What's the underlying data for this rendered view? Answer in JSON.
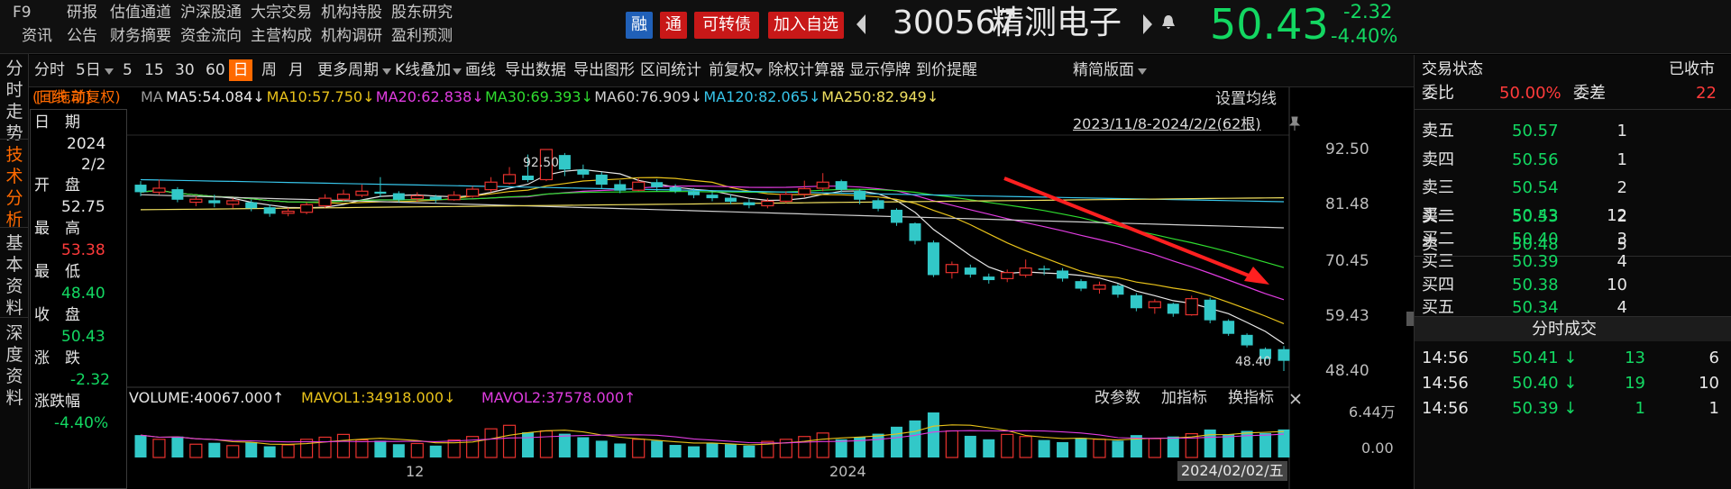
{
  "menu": {
    "row1": [
      "F9",
      "研报",
      "估值通道",
      "沪深股通",
      "大宗交易",
      "机构持股",
      "股东研究"
    ],
    "row2": [
      "资讯",
      "公告",
      "财务摘要",
      "资金流向",
      "主营构成",
      "机构调研",
      "盈利预测"
    ]
  },
  "header": {
    "tags": [
      "融",
      "通",
      "可转债",
      "加入自选"
    ],
    "code": "300567",
    "name": "精测电子",
    "price": "50.43",
    "change": "-2.32",
    "change_pct": "-4.40%"
  },
  "toolbar": {
    "items": [
      "分时",
      "5日",
      "5",
      "15",
      "30",
      "60",
      "日",
      "周",
      "月",
      "更多周期",
      "K线叠加",
      "画线",
      "导出数据",
      "导出图形",
      "区间统计",
      "前复权",
      "除权计算器",
      "显示停牌",
      "到价提醒"
    ],
    "right_label": "精简版面"
  },
  "left_nav": [
    "分时走势",
    "技术分析",
    "基本资料",
    "深度资料"
  ],
  "info": {
    "draggable": "[可拖动]",
    "date_label": "日　期",
    "year": "2024",
    "monthday": "2/2",
    "open_label": "开　盘",
    "open": "52.75",
    "high_label": "最　高",
    "high": "53.38",
    "low_label": "最　低",
    "low": "48.40",
    "close_label": "收　盘",
    "close": "50.43",
    "chg_label": "涨　跌",
    "chg": "-2.32",
    "chgpct_label": "涨跌幅",
    "chgpct": "-4.40%"
  },
  "chart": {
    "mode": "(日线,前复权)",
    "ma_label": "MA",
    "ma": [
      {
        "text": "MA5:54.084↓",
        "color": "#e8e8e8"
      },
      {
        "text": "MA10:57.750↓",
        "color": "#e8c21a"
      },
      {
        "text": "MA20:62.838↓",
        "color": "#e03ce0"
      },
      {
        "text": "MA30:69.393↓",
        "color": "#2fdd2f"
      },
      {
        "text": "MA60:76.909↓",
        "color": "#d0d0d0"
      },
      {
        "text": "MA120:82.065↓",
        "color": "#37c5ea"
      },
      {
        "text": "MA250:82.949↓",
        "color": "#f0e060"
      }
    ],
    "settings": "设置均线",
    "range": "2023/11/8-2024/2/2(62根)",
    "max_label": "92.50",
    "min_label": "48.40",
    "volume_text": "VOLUME:40067.000↑",
    "mavol1": "MAVOL1:34918.000↓",
    "mavol2": "MAVOL2:37578.000↑",
    "vol_buttons": [
      "改参数",
      "加指标",
      "换指标"
    ],
    "y_axis": [
      "92.50",
      "81.48",
      "70.45",
      "59.43",
      "48.40"
    ],
    "vol_axis": [
      "6.44万",
      "0.00"
    ],
    "x_labels": [
      "12",
      "2024"
    ],
    "cursor_date": "2024/02/02/五",
    "arrow_color": "#ff2020",
    "up_color": "#e8322e",
    "down_color": "#32c8c8"
  },
  "chart_data": {
    "type": "candlestick",
    "date_range": "2023/11/8-2024/2/2",
    "ylim": [
      48.4,
      92.5
    ],
    "candles": [
      [
        85.5,
        84.0,
        86.2,
        83.2
      ],
      [
        84.0,
        84.8,
        86.5,
        83.5
      ],
      [
        84.6,
        82.5,
        85.0,
        82.0
      ],
      [
        82.0,
        82.6,
        83.2,
        81.2
      ],
      [
        82.4,
        81.8,
        83.5,
        81.0
      ],
      [
        81.6,
        82.3,
        82.8,
        80.8
      ],
      [
        82.0,
        80.8,
        82.5,
        80.2
      ],
      [
        81.0,
        79.7,
        81.5,
        79.1
      ],
      [
        79.8,
        80.2,
        80.9,
        79.2
      ],
      [
        80.0,
        81.5,
        82.0,
        79.6
      ],
      [
        81.3,
        82.8,
        83.6,
        80.9
      ],
      [
        82.6,
        83.6,
        84.5,
        82.2
      ],
      [
        83.4,
        84.2,
        85.5,
        83.0
      ],
      [
        84.1,
        83.7,
        87.0,
        83.0
      ],
      [
        83.8,
        82.5,
        84.2,
        82.0
      ],
      [
        82.7,
        83.3,
        84.0,
        82.1
      ],
      [
        83.1,
        82.5,
        83.5,
        81.8
      ],
      [
        82.5,
        83.4,
        84.2,
        82.3
      ],
      [
        83.2,
        84.6,
        85.2,
        82.9
      ],
      [
        84.5,
        86.0,
        87.0,
        84.0
      ],
      [
        85.8,
        87.5,
        89.0,
        85.5
      ],
      [
        87.3,
        86.4,
        91.5,
        86.0
      ],
      [
        86.5,
        92.5,
        92.5,
        86.2
      ],
      [
        91.4,
        88.5,
        91.8,
        87.2
      ],
      [
        88.5,
        87.5,
        89.5,
        86.8
      ],
      [
        87.5,
        85.5,
        88.0,
        84.8
      ],
      [
        85.6,
        84.3,
        86.4,
        83.8
      ],
      [
        84.4,
        86.0,
        86.8,
        84.2
      ],
      [
        86.0,
        85.0,
        86.6,
        84.2
      ],
      [
        85.0,
        84.2,
        85.6,
        83.8
      ],
      [
        84.2,
        83.4,
        84.8,
        82.8
      ],
      [
        83.5,
        82.8,
        84.0,
        82.2
      ],
      [
        82.9,
        82.1,
        83.5,
        81.6
      ],
      [
        82.0,
        81.4,
        82.6,
        80.8
      ],
      [
        81.3,
        82.2,
        82.8,
        80.8
      ],
      [
        82.2,
        83.6,
        84.2,
        81.8
      ],
      [
        83.6,
        84.7,
        86.3,
        83.0
      ],
      [
        84.8,
        86.0,
        87.8,
        84.2
      ],
      [
        86.2,
        84.5,
        86.5,
        84.0
      ],
      [
        84.3,
        82.5,
        84.6,
        81.6
      ],
      [
        82.4,
        80.7,
        82.8,
        80.2
      ],
      [
        80.5,
        77.9,
        80.8,
        77.3
      ],
      [
        77.8,
        74.3,
        78.0,
        73.6
      ],
      [
        74.0,
        67.5,
        74.4,
        67.1
      ],
      [
        68.0,
        69.6,
        70.2,
        66.8
      ],
      [
        69.0,
        67.6,
        69.6,
        67.0
      ],
      [
        67.2,
        66.5,
        67.8,
        65.8
      ],
      [
        66.8,
        68.0,
        68.6,
        66.1
      ],
      [
        67.5,
        68.9,
        70.6,
        67.0
      ],
      [
        68.8,
        68.6,
        69.4,
        67.5
      ],
      [
        68.4,
        66.8,
        68.9,
        66.2
      ],
      [
        66.3,
        64.8,
        66.7,
        64.3
      ],
      [
        64.7,
        65.5,
        66.2,
        63.8
      ],
      [
        65.4,
        63.6,
        65.8,
        63.0
      ],
      [
        63.5,
        60.9,
        63.9,
        60.3
      ],
      [
        61.0,
        62.2,
        62.7,
        59.8
      ],
      [
        61.8,
        59.8,
        62.0,
        59.2
      ],
      [
        59.6,
        62.8,
        63.4,
        59.4
      ],
      [
        62.6,
        58.5,
        63.0,
        57.9
      ],
      [
        58.4,
        55.8,
        58.7,
        55.4
      ],
      [
        55.6,
        53.5,
        55.9,
        53.1
      ],
      [
        52.8,
        50.8,
        53.1,
        50.3
      ],
      [
        52.75,
        50.43,
        53.38,
        48.4
      ]
    ],
    "volume_max": "6.44万",
    "volumes": [
      3.2,
      2.6,
      3.0,
      1.9,
      2.1,
      1.7,
      2.2,
      1.6,
      1.8,
      2.6,
      2.9,
      3.3,
      2.5,
      2.4,
      1.9,
      2.0,
      1.7,
      2.5,
      3.0,
      4.1,
      4.6,
      3.6,
      3.8,
      3.4,
      2.9,
      2.4,
      2.0,
      2.6,
      2.4,
      1.8,
      1.6,
      2.0,
      1.9,
      1.7,
      2.3,
      2.6,
      3.0,
      3.5,
      2.6,
      2.9,
      3.4,
      4.4,
      5.3,
      6.44,
      3.8,
      3.1,
      2.6,
      3.3,
      3.0,
      2.5,
      2.2,
      2.8,
      2.6,
      2.4,
      3.2,
      2.7,
      3.0,
      3.4,
      4.0,
      3.3,
      3.8,
      3.5,
      4.0067
    ]
  },
  "orderbook": {
    "title": "交易状态",
    "status": "已收市",
    "weibi_label": "委比",
    "weibi": "50.00%",
    "weicha_label": "委差",
    "weicha": "22",
    "sells": [
      {
        "label": "卖五",
        "price": "50.57",
        "vol": "1"
      },
      {
        "label": "卖四",
        "price": "50.56",
        "vol": "1"
      },
      {
        "label": "卖三",
        "price": "50.54",
        "vol": "2"
      },
      {
        "label": "卖二",
        "price": "50.53",
        "vol": "2"
      },
      {
        "label": "卖一",
        "price": "50.48",
        "vol": "5"
      }
    ],
    "buys": [
      {
        "label": "买一",
        "price": "50.43",
        "vol": "12"
      },
      {
        "label": "买二",
        "price": "50.40",
        "vol": "3"
      },
      {
        "label": "买三",
        "price": "50.39",
        "vol": "4"
      },
      {
        "label": "买四",
        "price": "50.38",
        "vol": "10"
      },
      {
        "label": "买五",
        "price": "50.34",
        "vol": "4"
      }
    ],
    "ticks_title": "分时成交",
    "ticks": [
      {
        "time": "14:56",
        "price": "50.41 ↓",
        "vol": "13",
        "n": "6"
      },
      {
        "time": "14:56",
        "price": "50.40 ↓",
        "vol": "19",
        "n": "10"
      },
      {
        "time": "14:56",
        "price": "50.39 ↓",
        "vol": "1",
        "n": "1"
      }
    ]
  }
}
